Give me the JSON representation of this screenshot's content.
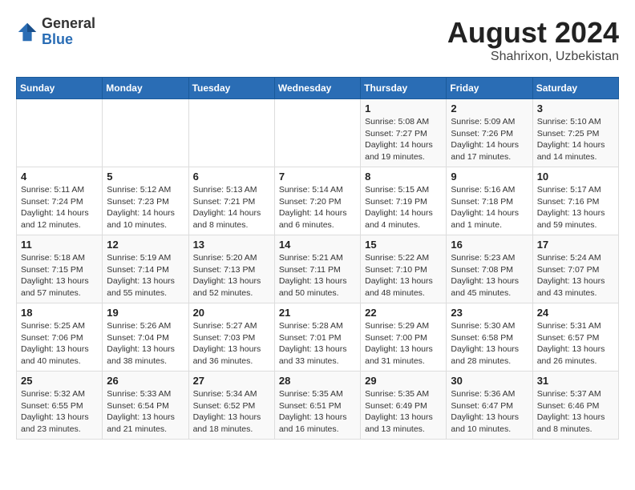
{
  "header": {
    "logo_general": "General",
    "logo_blue": "Blue",
    "main_title": "August 2024",
    "subtitle": "Shahrixon, Uzbekistan"
  },
  "calendar": {
    "days_of_week": [
      "Sunday",
      "Monday",
      "Tuesday",
      "Wednesday",
      "Thursday",
      "Friday",
      "Saturday"
    ],
    "weeks": [
      [
        {
          "day": "",
          "info": ""
        },
        {
          "day": "",
          "info": ""
        },
        {
          "day": "",
          "info": ""
        },
        {
          "day": "",
          "info": ""
        },
        {
          "day": "1",
          "info": "Sunrise: 5:08 AM\nSunset: 7:27 PM\nDaylight: 14 hours\nand 19 minutes."
        },
        {
          "day": "2",
          "info": "Sunrise: 5:09 AM\nSunset: 7:26 PM\nDaylight: 14 hours\nand 17 minutes."
        },
        {
          "day": "3",
          "info": "Sunrise: 5:10 AM\nSunset: 7:25 PM\nDaylight: 14 hours\nand 14 minutes."
        }
      ],
      [
        {
          "day": "4",
          "info": "Sunrise: 5:11 AM\nSunset: 7:24 PM\nDaylight: 14 hours\nand 12 minutes."
        },
        {
          "day": "5",
          "info": "Sunrise: 5:12 AM\nSunset: 7:23 PM\nDaylight: 14 hours\nand 10 minutes."
        },
        {
          "day": "6",
          "info": "Sunrise: 5:13 AM\nSunset: 7:21 PM\nDaylight: 14 hours\nand 8 minutes."
        },
        {
          "day": "7",
          "info": "Sunrise: 5:14 AM\nSunset: 7:20 PM\nDaylight: 14 hours\nand 6 minutes."
        },
        {
          "day": "8",
          "info": "Sunrise: 5:15 AM\nSunset: 7:19 PM\nDaylight: 14 hours\nand 4 minutes."
        },
        {
          "day": "9",
          "info": "Sunrise: 5:16 AM\nSunset: 7:18 PM\nDaylight: 14 hours\nand 1 minute."
        },
        {
          "day": "10",
          "info": "Sunrise: 5:17 AM\nSunset: 7:16 PM\nDaylight: 13 hours\nand 59 minutes."
        }
      ],
      [
        {
          "day": "11",
          "info": "Sunrise: 5:18 AM\nSunset: 7:15 PM\nDaylight: 13 hours\nand 57 minutes."
        },
        {
          "day": "12",
          "info": "Sunrise: 5:19 AM\nSunset: 7:14 PM\nDaylight: 13 hours\nand 55 minutes."
        },
        {
          "day": "13",
          "info": "Sunrise: 5:20 AM\nSunset: 7:13 PM\nDaylight: 13 hours\nand 52 minutes."
        },
        {
          "day": "14",
          "info": "Sunrise: 5:21 AM\nSunset: 7:11 PM\nDaylight: 13 hours\nand 50 minutes."
        },
        {
          "day": "15",
          "info": "Sunrise: 5:22 AM\nSunset: 7:10 PM\nDaylight: 13 hours\nand 48 minutes."
        },
        {
          "day": "16",
          "info": "Sunrise: 5:23 AM\nSunset: 7:08 PM\nDaylight: 13 hours\nand 45 minutes."
        },
        {
          "day": "17",
          "info": "Sunrise: 5:24 AM\nSunset: 7:07 PM\nDaylight: 13 hours\nand 43 minutes."
        }
      ],
      [
        {
          "day": "18",
          "info": "Sunrise: 5:25 AM\nSunset: 7:06 PM\nDaylight: 13 hours\nand 40 minutes."
        },
        {
          "day": "19",
          "info": "Sunrise: 5:26 AM\nSunset: 7:04 PM\nDaylight: 13 hours\nand 38 minutes."
        },
        {
          "day": "20",
          "info": "Sunrise: 5:27 AM\nSunset: 7:03 PM\nDaylight: 13 hours\nand 36 minutes."
        },
        {
          "day": "21",
          "info": "Sunrise: 5:28 AM\nSunset: 7:01 PM\nDaylight: 13 hours\nand 33 minutes."
        },
        {
          "day": "22",
          "info": "Sunrise: 5:29 AM\nSunset: 7:00 PM\nDaylight: 13 hours\nand 31 minutes."
        },
        {
          "day": "23",
          "info": "Sunrise: 5:30 AM\nSunset: 6:58 PM\nDaylight: 13 hours\nand 28 minutes."
        },
        {
          "day": "24",
          "info": "Sunrise: 5:31 AM\nSunset: 6:57 PM\nDaylight: 13 hours\nand 26 minutes."
        }
      ],
      [
        {
          "day": "25",
          "info": "Sunrise: 5:32 AM\nSunset: 6:55 PM\nDaylight: 13 hours\nand 23 minutes."
        },
        {
          "day": "26",
          "info": "Sunrise: 5:33 AM\nSunset: 6:54 PM\nDaylight: 13 hours\nand 21 minutes."
        },
        {
          "day": "27",
          "info": "Sunrise: 5:34 AM\nSunset: 6:52 PM\nDaylight: 13 hours\nand 18 minutes."
        },
        {
          "day": "28",
          "info": "Sunrise: 5:35 AM\nSunset: 6:51 PM\nDaylight: 13 hours\nand 16 minutes."
        },
        {
          "day": "29",
          "info": "Sunrise: 5:35 AM\nSunset: 6:49 PM\nDaylight: 13 hours\nand 13 minutes."
        },
        {
          "day": "30",
          "info": "Sunrise: 5:36 AM\nSunset: 6:47 PM\nDaylight: 13 hours\nand 10 minutes."
        },
        {
          "day": "31",
          "info": "Sunrise: 5:37 AM\nSunset: 6:46 PM\nDaylight: 13 hours\nand 8 minutes."
        }
      ]
    ]
  }
}
